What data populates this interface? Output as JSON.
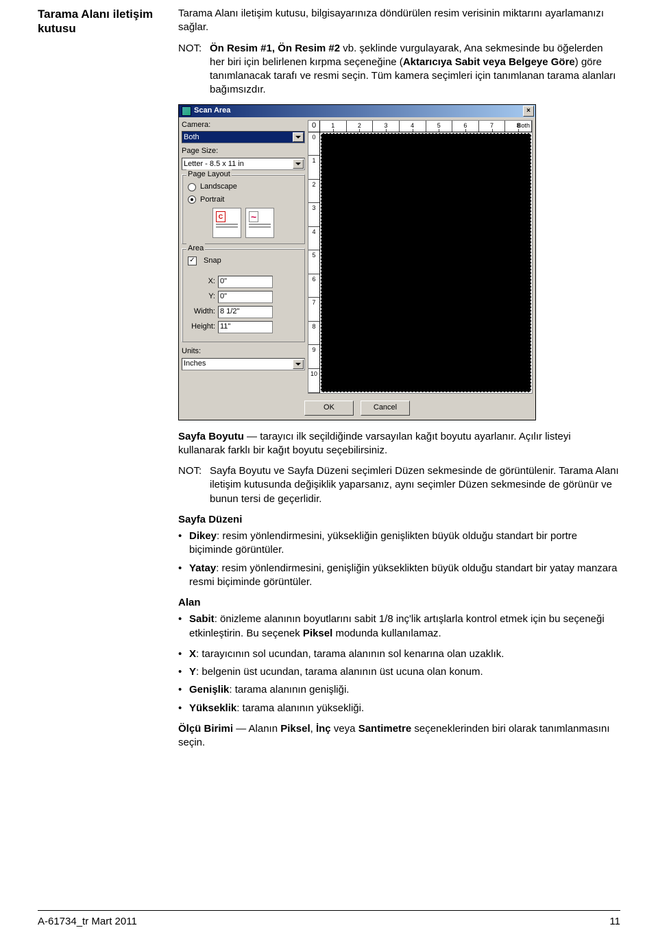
{
  "side_title": "Tarama Alanı iletişim kutusu",
  "intro": "Tarama Alanı iletişim kutusu, bilgisayarınıza döndürülen resim verisinin miktarını ayarlamanızı sağlar.",
  "note1_label": "NOT:",
  "note1_body_pre": "Ön Resim #1, Ön Resim #2",
  "note1_body_rest1": " vb. şeklinde vurgulayarak, Ana sekmesinde bu öğelerden her biri için belirlenen kırpma seçeneğine (",
  "note1_bold_opt": "Aktarıcıya Sabit veya Belgeye Göre",
  "note1_body_rest2": ") göre tanımlanacak tarafı ve resmi seçin. Tüm kamera seçimleri için tanımlanan tarama alanları bağımsızdır.",
  "dialog": {
    "title": "Scan Area",
    "camera_label": "Camera:",
    "camera_value": "Both",
    "page_size_label": "Page Size:",
    "page_size_value": "Letter - 8.5 x 11 in",
    "page_layout_label": "Page Layout",
    "landscape": "Landscape",
    "portrait": "Portrait",
    "portrait_checked": true,
    "area_label": "Area",
    "snap_label": "Snap",
    "snap_checked": true,
    "x_label": "X:",
    "x_value": "0\"",
    "y_label": "Y:",
    "y_value": "0\"",
    "w_label": "Width:",
    "w_value": "8 1/2\"",
    "h_label": "Height:",
    "h_value": "11\"",
    "units_label": "Units:",
    "units_value": "Inches",
    "ok": "OK",
    "cancel": "Cancel",
    "ruler_corner": "Both",
    "ruler_origin": "0",
    "ruler_top": [
      "1",
      "2",
      "3",
      "4",
      "5",
      "6",
      "7",
      "8"
    ],
    "ruler_left": [
      "0",
      "1",
      "2",
      "3",
      "4",
      "5",
      "6",
      "7",
      "8",
      "9",
      "10"
    ]
  },
  "sb_head": "Sayfa Boyutu",
  "sb_text": " — tarayıcı ilk seçildiğinde varsayılan kağıt boyutu ayarlanır. Açılır listeyi kullanarak farklı bir kağıt boyutu seçebilirsiniz.",
  "note2_label": "NOT:",
  "note2_body": "Sayfa Boyutu ve Sayfa Düzeni seçimleri Düzen sekmesinde de görüntülenir. Tarama Alanı iletişim kutusunda değişiklik yaparsanız, aynı seçimler Düzen sekmesinde de görünür ve bunun tersi de geçerlidir.",
  "sd_head": "Sayfa Düzeni",
  "sd_items": [
    {
      "b": "Dikey",
      "t": ": resim yönlendirmesini, yüksekliğin genişlikten büyük olduğu standart bir portre biçiminde görüntüler."
    },
    {
      "b": "Yatay",
      "t": ": resim yönlendirmesini, genişliğin yükseklikten büyük olduğu standart bir yatay manzara resmi biçiminde görüntüler."
    }
  ],
  "alan_head": "Alan",
  "alan_sabit_b": "Sabit",
  "alan_sabit_t1": ": önizleme alanının boyutlarını sabit 1/8 inç'lik artışlarla kontrol etmek için bu seçeneği etkinleştirin. Bu seçenek ",
  "alan_sabit_bold": "Piksel",
  "alan_sabit_t2": " modunda kullanılamaz.",
  "alan_items": [
    {
      "b": "X",
      "t": ": tarayıcının sol ucundan, tarama alanının sol kenarına olan uzaklık."
    },
    {
      "b": "Y",
      "t": ": belgenin üst ucundan, tarama alanının üst ucuna olan konum."
    },
    {
      "b": "Genişlik",
      "t": ": tarama alanının genişliği."
    },
    {
      "b": "Yükseklik",
      "t": ": tarama alanının yüksekliği."
    }
  ],
  "olcu_head": "Ölçü Birimi",
  "olcu_pre": " — Alanın ",
  "olcu_b1": "Piksel",
  "olcu_c1": ", ",
  "olcu_b2": "İnç",
  "olcu_c2": " veya ",
  "olcu_b3": "Santimetre",
  "olcu_post": " seçeneklerinden biri olarak tanımlanmasını seçin.",
  "footer_left": "A-61734_tr  Mart 2011",
  "footer_right": "11"
}
